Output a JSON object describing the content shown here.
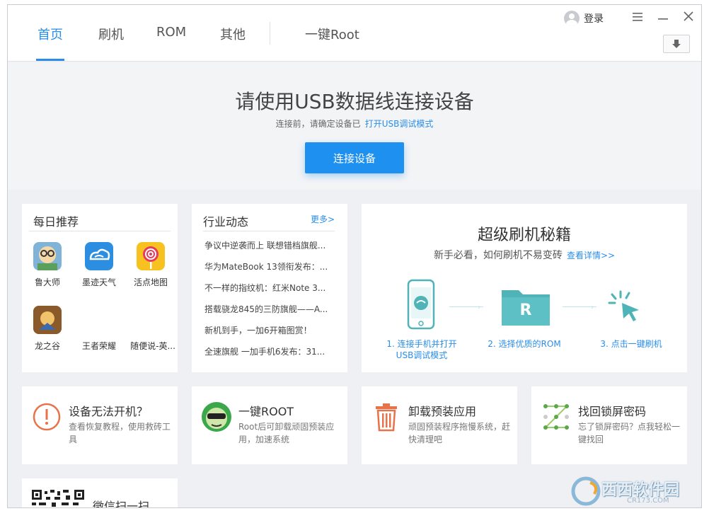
{
  "nav": {
    "tabs": [
      "首页",
      "刷机",
      "ROM",
      "其他",
      "一键Root"
    ],
    "login": "登录"
  },
  "hero": {
    "title": "请使用USB数据线连接设备",
    "subtitle": "连接前，请确定设备已",
    "subtitle_link": "打开USB调试模式",
    "connect_button": "连接设备"
  },
  "daily": {
    "title": "每日推荐",
    "apps": [
      "鲁大师",
      "墨迹天气",
      "活点地图",
      "龙之谷",
      "王者荣耀",
      "随便说-英..."
    ]
  },
  "news": {
    "title": "行业动态",
    "more": "更多>",
    "items": [
      "争议中逆袭而上 联想错档旗舰...",
      "华为MateBook 13领衔发布：...",
      "不一样的指纹机：红米Note 3...",
      "搭载骁龙845的三防旗舰——A...",
      "新机到手，一加6开箱图赏！",
      "全速旗舰 一加手机6发布：31..."
    ]
  },
  "guide": {
    "title": "超级刷机秘籍",
    "subtitle": "新手必看，如何刷机不易变砖",
    "link": "查看详情>>",
    "step1_line1": "1. 连接手机并打开",
    "step1_line2": "USB调试模式",
    "step2": "2. 选择优质的ROM",
    "step3": "3. 点击一键刷机",
    "rom_letter": "R"
  },
  "features": [
    {
      "title": "设备无法开机？",
      "desc": "查看恢复教程，使用救砖工具"
    },
    {
      "title": "一键ROOT",
      "desc": "Root后可卸载顽固预装应用，加速系统"
    },
    {
      "title": "卸载预装应用",
      "desc": "顽固预装程序拖慢系统，赶快清理吧"
    },
    {
      "title": "找回锁屏密码",
      "desc": "忘了锁屏密码？点我轻松一键找回"
    }
  ],
  "wechat": {
    "label": "微信扫一扫"
  },
  "watermark": {
    "text": "西西软件园",
    "sub": "CR173.COM"
  },
  "colors": {
    "accent": "#2a8ee8",
    "button": "#1e90f0",
    "teal": "#4fb3b7",
    "orange": "#e8734a"
  }
}
